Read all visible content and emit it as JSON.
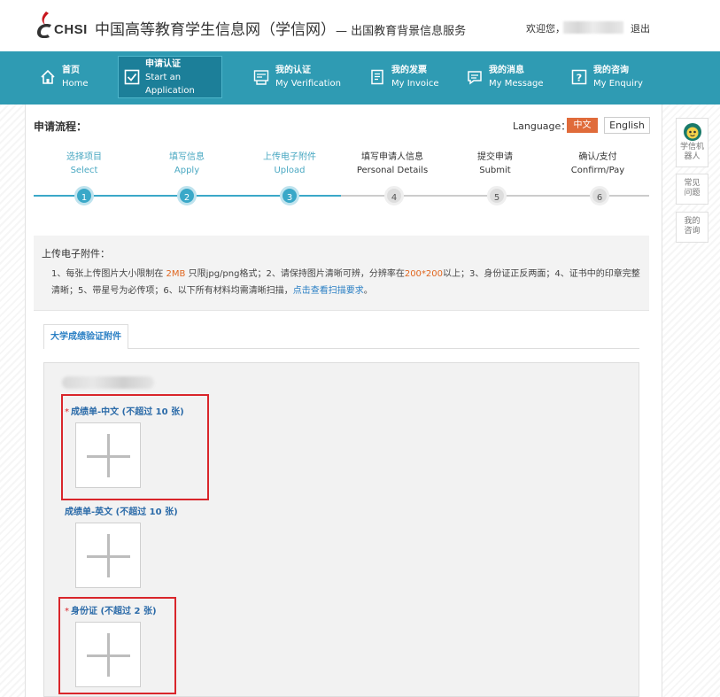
{
  "header": {
    "logo_text": "CHSI",
    "site_title": "中国高等教育学生信息网（学信网）",
    "site_subtitle": "— 出国教育背景信息服务",
    "welcome": "欢迎您，",
    "logout": "退出"
  },
  "nav": {
    "items": [
      {
        "cn": "首页",
        "en": "Home",
        "icon": "home-icon"
      },
      {
        "cn": "申请认证",
        "en": "Start an Application",
        "icon": "check-icon"
      },
      {
        "cn": "我的认证",
        "en": "My Verification",
        "icon": "certificate-icon"
      },
      {
        "cn": "我的发票",
        "en": "My Invoice",
        "icon": "invoice-icon"
      },
      {
        "cn": "我的消息",
        "en": "My Message",
        "icon": "message-icon"
      },
      {
        "cn": "我的咨询",
        "en": "My Enquiry",
        "icon": "question-icon"
      }
    ]
  },
  "flow": {
    "title": "申请流程：",
    "language_label": "Language：",
    "lang_cn": "中文",
    "lang_en": "English",
    "steps": [
      {
        "cn": "选择项目",
        "en": "Select",
        "num": "1"
      },
      {
        "cn": "填写信息",
        "en": "Apply",
        "num": "2"
      },
      {
        "cn": "上传电子附件",
        "en": "Upload",
        "num": "3"
      },
      {
        "cn": "填写申请人信息",
        "en": "Personal Details",
        "num": "4"
      },
      {
        "cn": "提交申请",
        "en": "Submit",
        "num": "5"
      },
      {
        "cn": "确认/支付",
        "en": "Confirm/Pay",
        "num": "6"
      }
    ],
    "current_step": 3
  },
  "notice": {
    "title": "上传电子附件：",
    "p1": "1、每张上传图片大小限制在 ",
    "size": "2MB",
    "p2": " 只限jpg/png格式；2、请保持图片清晰可辨，分辨率在",
    "resolution": "200*200",
    "p3": "以上；3、身份证正反两面；4、证书中的印章完整清晰；5、带星号为必传项；6、以下所有材料均需清晰扫描，",
    "link": "点击查看扫描要求",
    "p4": "。"
  },
  "tabs": {
    "active": "大学成绩验证附件"
  },
  "upload": {
    "fields": [
      {
        "label": "成绩单-中文 (不超过 10 张)",
        "required": true
      },
      {
        "label": "成绩单-英文 (不超过 10 张)",
        "required": false
      },
      {
        "label": "身份证 (不超过 2 张)",
        "required": true
      }
    ],
    "required_mark": "*"
  },
  "sidebar": {
    "robot": "学信机器人",
    "faq": "常见问题",
    "enquiry": "我的咨询"
  },
  "colors": {
    "nav_bg": "#2f9bb3",
    "active_step": "#3aa8c8",
    "highlight": "#d9262b",
    "accent_orange": "#e06b3a"
  }
}
